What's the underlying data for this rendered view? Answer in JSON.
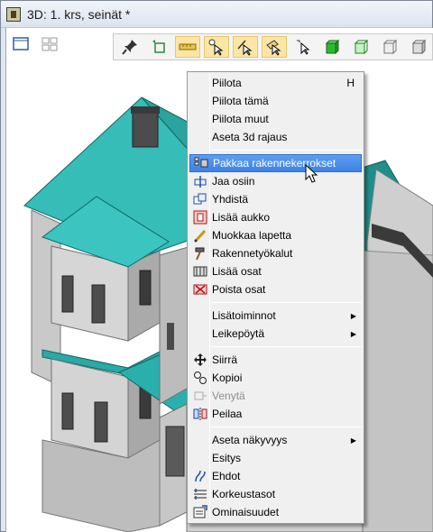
{
  "window": {
    "title": "3D: 1. krs, seinät *"
  },
  "toolbar": {
    "left": [
      "single-view-icon",
      "grid-view-icon"
    ],
    "right": [
      "pin-icon",
      "rotate-frame-icon",
      "ruler-icon",
      "select-point-icon",
      "select-edge-icon",
      "select-face-icon",
      "select-pointer-icon",
      "cube-green-solid-icon",
      "cube-green-wire-icon",
      "cube-gray-wire-icon",
      "cube-gray-icon"
    ]
  },
  "context_menu": {
    "items": [
      {
        "label": "Piilota",
        "shortcut": "H"
      },
      {
        "label": "Piilota tämä"
      },
      {
        "label": "Piilota muut"
      },
      {
        "label": "Aseta 3d rajaus"
      },
      {
        "label": "Pakkaa rakennekerrokset",
        "icon": "pack-layers-icon",
        "state": "highlighted"
      },
      {
        "label": "Jaa osiin",
        "icon": "split-icon"
      },
      {
        "label": "Yhdistä",
        "icon": "merge-icon"
      },
      {
        "label": "Lisää aukko",
        "icon": "add-opening-icon"
      },
      {
        "label": "Muokkaa lapetta",
        "icon": "edit-slope-icon"
      },
      {
        "label": "Rakennetyökalut",
        "icon": "hammer-icon"
      },
      {
        "label": "Lisää osat",
        "icon": "add-parts-icon"
      },
      {
        "label": "Poista osat",
        "icon": "remove-parts-icon"
      },
      {
        "label": "Lisätoiminnot",
        "submenu": true
      },
      {
        "label": "Leikepöytä",
        "submenu": true
      },
      {
        "label": "Siirrä",
        "icon": "move-icon"
      },
      {
        "label": "Kopioi",
        "icon": "copy-icon"
      },
      {
        "label": "Venytä",
        "icon": "stretch-icon",
        "state": "disabled"
      },
      {
        "label": "Peilaa",
        "icon": "mirror-icon"
      },
      {
        "label": "Aseta näkyvyys",
        "submenu": true
      },
      {
        "label": "Esitys"
      },
      {
        "label": "Ehdot",
        "icon": "conditions-icon"
      },
      {
        "label": "Korkeustasot",
        "icon": "levels-icon"
      },
      {
        "label": "Ominaisuudet",
        "icon": "properties-icon"
      }
    ]
  },
  "colors": {
    "roof": "#2aa9a5",
    "wall": "#d2d2d2",
    "highlight": "#3d83e6"
  }
}
